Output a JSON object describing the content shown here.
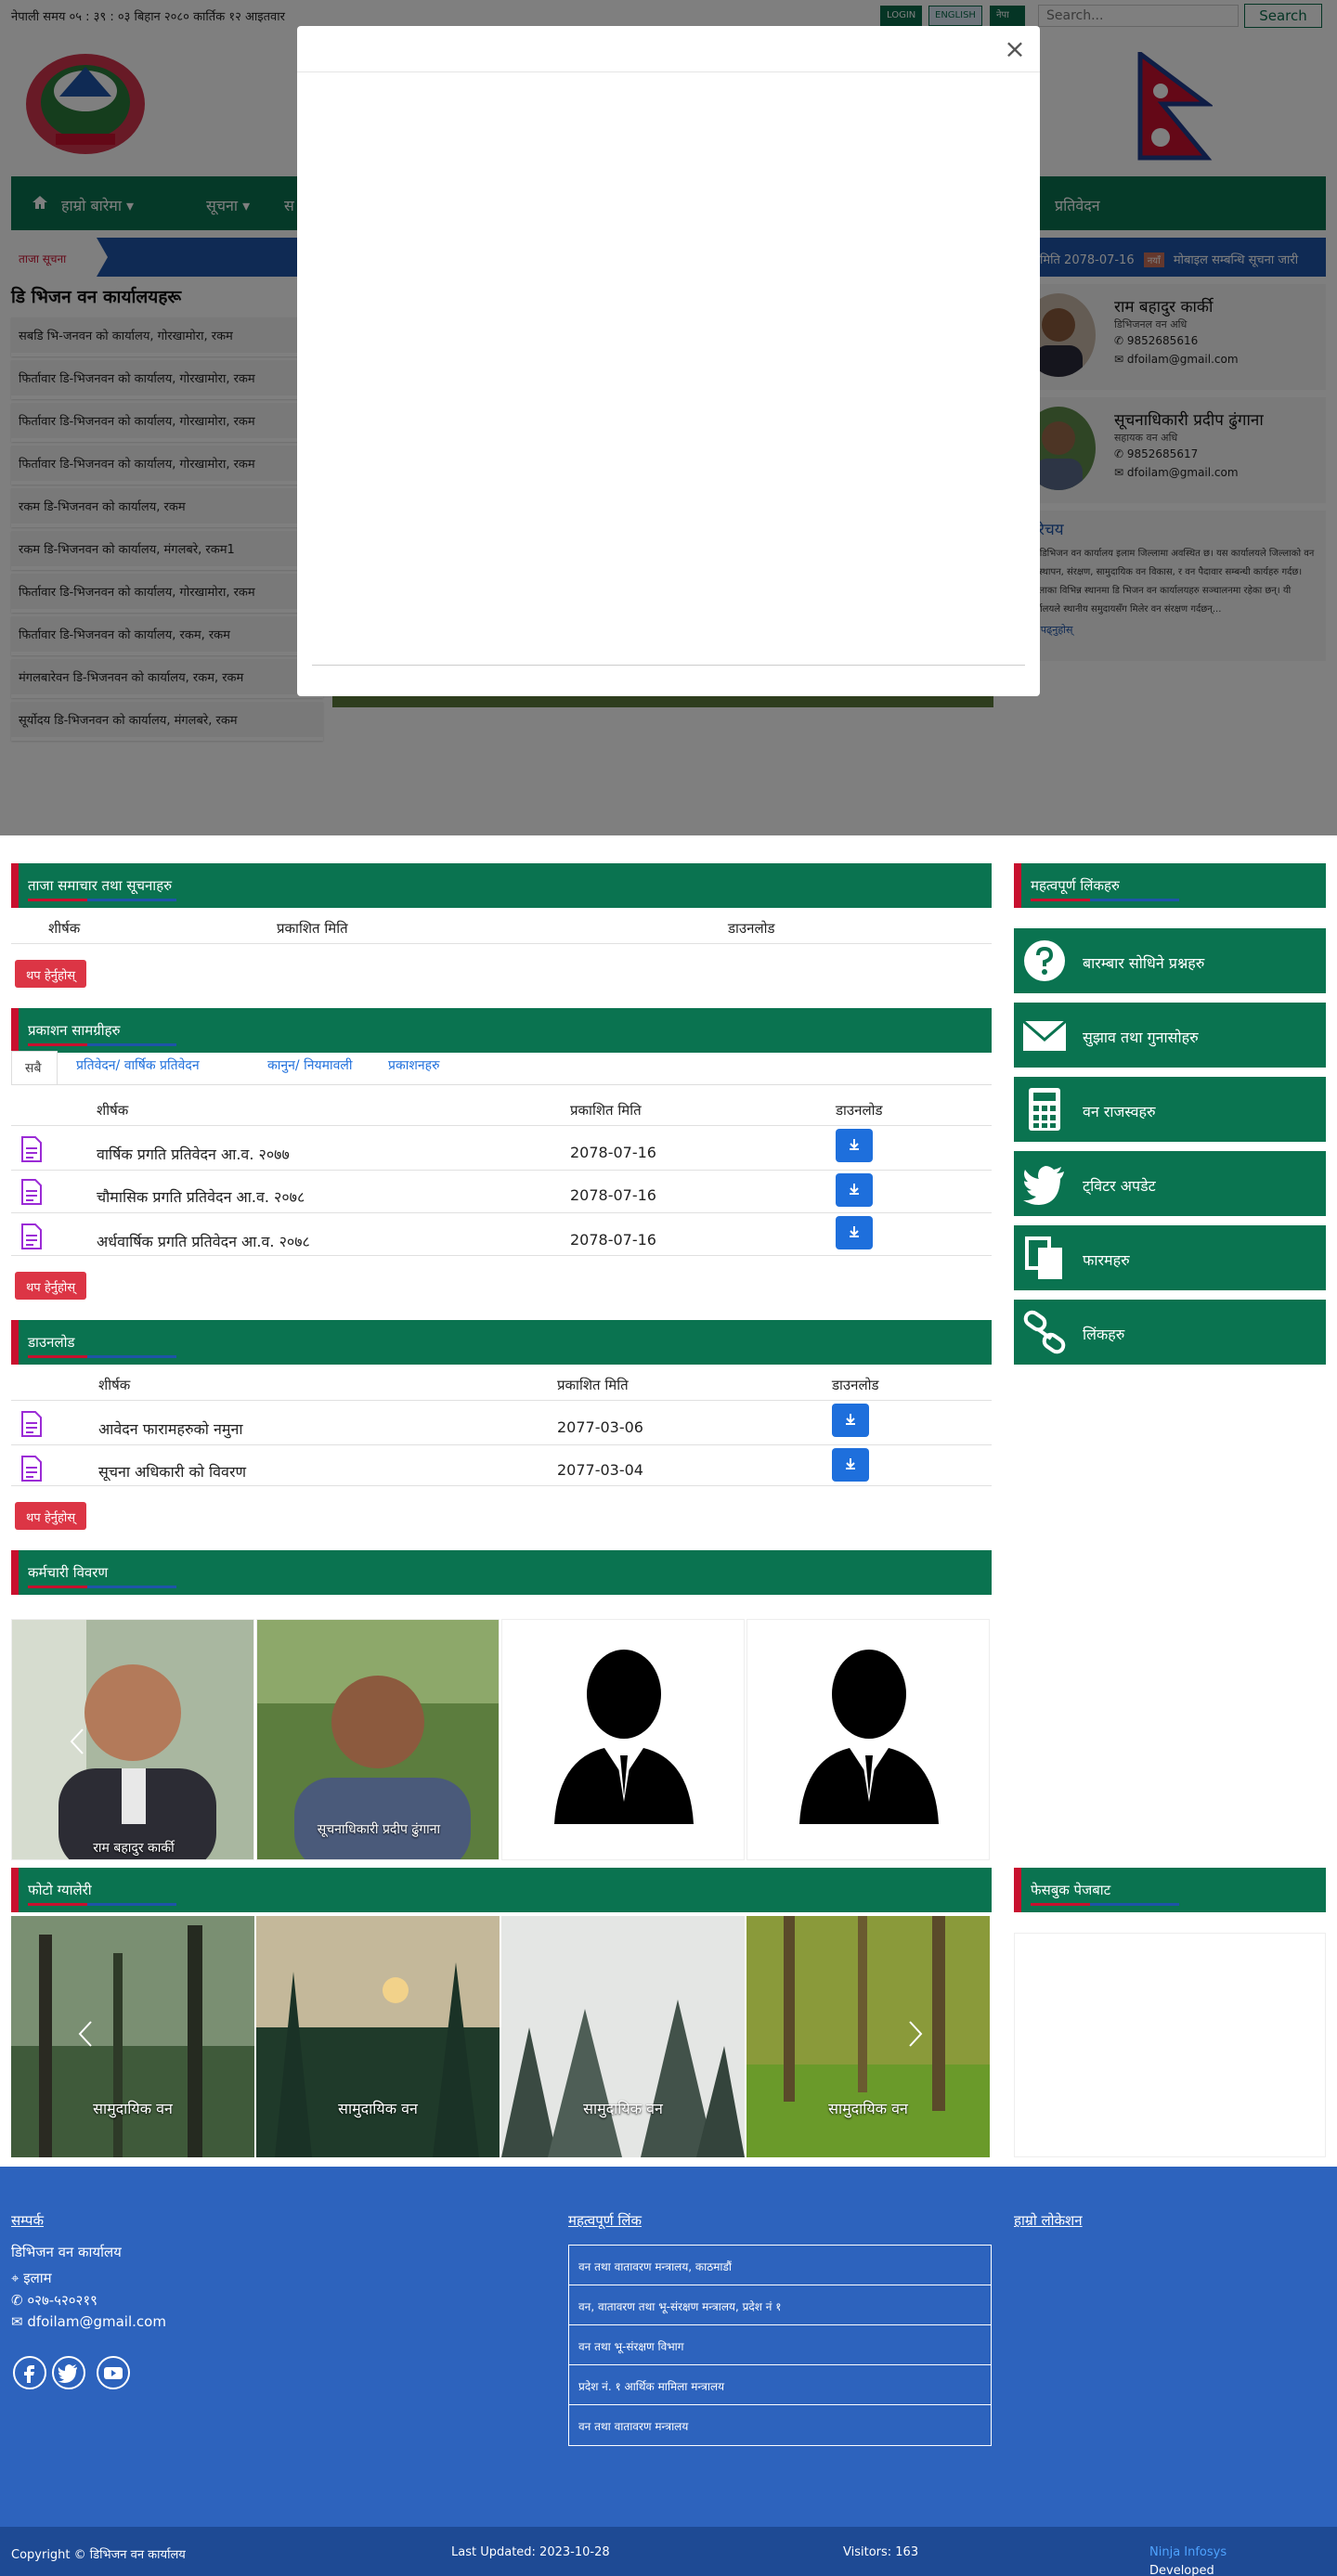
{
  "topbar": {
    "nepali_time": "नेपाली समय ०५ : ३९ : ०३ बिहान   २०८० कार्तिक १२ आइतवार",
    "login": "LOGIN",
    "english": "ENGLISH",
    "nepali": "नेपा",
    "search_placeholder": "Search...",
    "search_button": "Search"
  },
  "nav": {
    "items": [
      "हाम्रो बारेमा ▾",
      "सूचना ▾",
      "स",
      "प्रतिवेदन"
    ]
  },
  "ticker": {
    "label": "ताजा सूचना",
    "date": "मिति 2078-07-16",
    "badge": "नयाँ",
    "text": "मोबाइल सम्बन्धि सूचना जारी"
  },
  "offices": {
    "title": "डि भिजन वन कार्यालयहरू",
    "items": [
      "सबडि भि-जनवन को कार्यालय, गोरखामोरा, रकम",
      "फिर्तावार डि-भिजनवन को कार्यालय, गोरखामोरा, रकम",
      "फिर्तावार डि-भिजनवन को कार्यालय, गोरखामोरा, रकम",
      "फिर्तावार डि-भिजनवन को कार्यालय, गोरखामोरा, रकम",
      "रकम डि-भिजनवन को कार्यालय, रकम",
      "रकम डि-भिजनवन को कार्यालय, मंगलबरे, रकम1",
      "फिर्तावार डि-भिजनवन को कार्यालय, गोरखामोरा, रकम",
      "फिर्तावार डि-भिजनवन को कार्यालय, रकम, रकम",
      "मंगलबारेवन डि-भिजनवन को कार्यालय, रकम, रकम",
      "सूर्योदय डि-भिजनवन को कार्यालय, मंगलबरे, रकम"
    ]
  },
  "officials": [
    {
      "name": "राम बहादुर कार्की",
      "post": "डिभिजनल वन अधि",
      "phone": "9852685616",
      "email": "dfoilam@gmail.com"
    },
    {
      "name": "सूचनाधिकारी प्रदीप ढुंगाना",
      "post": "सहायक वन अधि",
      "phone": "9852685617",
      "email": "dfoilam@gmail.com"
    }
  ],
  "about": {
    "title": "परिचय",
    "text": "यस डिभिजन वन कार्यालय इलाम जिल्लामा अवस्थित छ। यस कार्यालयले जिल्लाको वन व्यवस्थापन, संरक्षण, सामुदायिक वन विकास, र वन पैदावार सम्बन्धी कार्यहरु गर्दछ। जिल्लाका विभिन्न स्थानमा डि भिजन वन कार्यालयहरु सञ्चालनमा रहेका छन्। यी कार्यालयले स्थानीय समुदायसँग मिलेर वन संरक्षण गर्दछन्...",
    "more": "थप पढ्नुहोस्"
  },
  "modal": {
    "close": "×"
  },
  "latest_news": {
    "title": "ताजा समाचार तथा सूचनाहरु",
    "headers": [
      "शीर्षक",
      "प्रकाशित मिति",
      "डाउनलोड"
    ],
    "more": "थप हेर्नुहोस्"
  },
  "publications": {
    "title": "प्रकाशन सामग्रीहरु",
    "tabs": [
      "सबै",
      "प्रतिवेदन/ वार्षिक प्रतिवेदन",
      "कानुन/ नियमावली",
      "प्रकाशनहरु"
    ],
    "headers": [
      "शीर्षक",
      "प्रकाशित मिति",
      "डाउनलोड"
    ],
    "rows": [
      {
        "title": "वार्षिक प्रगति प्रतिवेदन आ.व. २०७७",
        "date": "2078-07-16"
      },
      {
        "title": "चौमासिक प्रगति प्रतिवेदन आ.व. २०७८",
        "date": "2078-07-16"
      },
      {
        "title": "अर्धवार्षिक प्रगति प्रतिवेदन आ.व. २०७८",
        "date": "2078-07-16"
      }
    ],
    "more": "थप हेर्नुहोस्"
  },
  "downloads": {
    "title": "डाउनलोड",
    "headers": [
      "शीर्षक",
      "प्रकाशित मिति",
      "डाउनलोड"
    ],
    "rows": [
      {
        "title": "आवेदन फारामहरुको नमुना",
        "date": "2077-03-06"
      },
      {
        "title": "सूचना अधिकारी को विवरण",
        "date": "2077-03-04"
      }
    ],
    "more": "थप हेर्नुहोस्"
  },
  "employees": {
    "title": "कर्मचारी विवरण",
    "cards": [
      {
        "name": "राम बहादुर कार्की"
      },
      {
        "name": "सूचनाधिकारी प्रदीप ढुंगाना"
      },
      {
        "name": ""
      },
      {
        "name": ""
      }
    ]
  },
  "gallery": {
    "title": "फोटो ग्यालेरी",
    "captions": [
      "सामुदायिक वन",
      "सामुदायिक वन",
      "सामुदायिक वन",
      "सामुदायिक वन"
    ]
  },
  "quick_links": {
    "title": "महत्वपूर्ण लिंकहरु",
    "items": [
      {
        "label": "बारम्बार सोधिने प्रश्नहरु",
        "icon": "question-icon"
      },
      {
        "label": "सुझाव तथा गुनासोहरु",
        "icon": "envelope-icon"
      },
      {
        "label": "वन राजस्वहरु",
        "icon": "calculator-icon"
      },
      {
        "label": "ट्विटर अपडेट",
        "icon": "twitter-icon"
      },
      {
        "label": "फारमहरु",
        "icon": "copy-icon"
      },
      {
        "label": "लिंकहरु",
        "icon": "link-icon"
      }
    ]
  },
  "facebook": {
    "title": "फेसबुक पेजबाट"
  },
  "footer": {
    "contact_title": "सम्पर्क",
    "office_name": "डिभिजन वन कार्यालय",
    "address": "इलाम",
    "phone": "०२७-५२०२१९",
    "email": "dfoilam@gmail.com",
    "links_title": "महत्वपूर्ण लिंक",
    "links": [
      "वन तथा वातावरण मन्त्रालय, काठमाडौं",
      "वन, वातावरण तथा भू-संरक्षण मन्त्रालय, प्रदेश नं १",
      "वन तथा भू-संरक्षण विभाग",
      "प्रदेश नं. १ आर्थिक मामिला मन्त्रालय",
      "वन तथा वातावरण मन्त्रालय"
    ],
    "map_title": "हाम्रो लोकेशन"
  },
  "bottombar": {
    "copyright": "Copyright © डिभिजन वन कार्यालय",
    "updated": "Last Updated: 2023-10-28",
    "visitors": "Visitors: 163",
    "developed_label": "Developed By:",
    "developer": "Ninja Infosys"
  },
  "colors": {
    "primary_green": "#0a7350",
    "accent_red": "#c8102e",
    "footer_blue": "#2d63bd",
    "link_blue": "#1e6fdc"
  }
}
